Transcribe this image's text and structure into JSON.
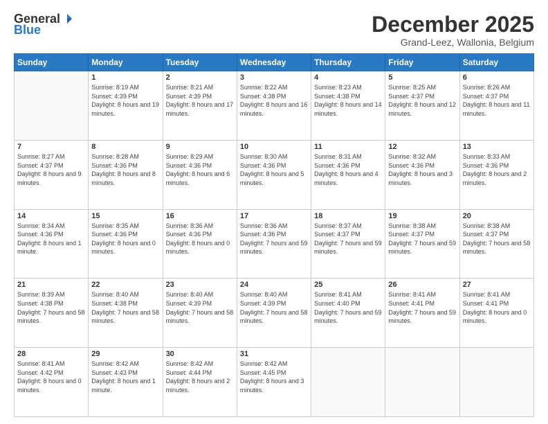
{
  "logo": {
    "general": "General",
    "blue": "Blue"
  },
  "header": {
    "month": "December 2025",
    "location": "Grand-Leez, Wallonia, Belgium"
  },
  "weekdays": [
    "Sunday",
    "Monday",
    "Tuesday",
    "Wednesday",
    "Thursday",
    "Friday",
    "Saturday"
  ],
  "weeks": [
    [
      {
        "day": "",
        "sunrise": "",
        "sunset": "",
        "daylight": ""
      },
      {
        "day": "1",
        "sunrise": "Sunrise: 8:19 AM",
        "sunset": "Sunset: 4:39 PM",
        "daylight": "Daylight: 8 hours and 19 minutes."
      },
      {
        "day": "2",
        "sunrise": "Sunrise: 8:21 AM",
        "sunset": "Sunset: 4:39 PM",
        "daylight": "Daylight: 8 hours and 17 minutes."
      },
      {
        "day": "3",
        "sunrise": "Sunrise: 8:22 AM",
        "sunset": "Sunset: 4:38 PM",
        "daylight": "Daylight: 8 hours and 16 minutes."
      },
      {
        "day": "4",
        "sunrise": "Sunrise: 8:23 AM",
        "sunset": "Sunset: 4:38 PM",
        "daylight": "Daylight: 8 hours and 14 minutes."
      },
      {
        "day": "5",
        "sunrise": "Sunrise: 8:25 AM",
        "sunset": "Sunset: 4:37 PM",
        "daylight": "Daylight: 8 hours and 12 minutes."
      },
      {
        "day": "6",
        "sunrise": "Sunrise: 8:26 AM",
        "sunset": "Sunset: 4:37 PM",
        "daylight": "Daylight: 8 hours and 11 minutes."
      }
    ],
    [
      {
        "day": "7",
        "sunrise": "Sunrise: 8:27 AM",
        "sunset": "Sunset: 4:37 PM",
        "daylight": "Daylight: 8 hours and 9 minutes."
      },
      {
        "day": "8",
        "sunrise": "Sunrise: 8:28 AM",
        "sunset": "Sunset: 4:36 PM",
        "daylight": "Daylight: 8 hours and 8 minutes."
      },
      {
        "day": "9",
        "sunrise": "Sunrise: 8:29 AM",
        "sunset": "Sunset: 4:36 PM",
        "daylight": "Daylight: 8 hours and 6 minutes."
      },
      {
        "day": "10",
        "sunrise": "Sunrise: 8:30 AM",
        "sunset": "Sunset: 4:36 PM",
        "daylight": "Daylight: 8 hours and 5 minutes."
      },
      {
        "day": "11",
        "sunrise": "Sunrise: 8:31 AM",
        "sunset": "Sunset: 4:36 PM",
        "daylight": "Daylight: 8 hours and 4 minutes."
      },
      {
        "day": "12",
        "sunrise": "Sunrise: 8:32 AM",
        "sunset": "Sunset: 4:36 PM",
        "daylight": "Daylight: 8 hours and 3 minutes."
      },
      {
        "day": "13",
        "sunrise": "Sunrise: 8:33 AM",
        "sunset": "Sunset: 4:36 PM",
        "daylight": "Daylight: 8 hours and 2 minutes."
      }
    ],
    [
      {
        "day": "14",
        "sunrise": "Sunrise: 8:34 AM",
        "sunset": "Sunset: 4:36 PM",
        "daylight": "Daylight: 8 hours and 1 minute."
      },
      {
        "day": "15",
        "sunrise": "Sunrise: 8:35 AM",
        "sunset": "Sunset: 4:36 PM",
        "daylight": "Daylight: 8 hours and 0 minutes."
      },
      {
        "day": "16",
        "sunrise": "Sunrise: 8:36 AM",
        "sunset": "Sunset: 4:36 PM",
        "daylight": "Daylight: 8 hours and 0 minutes."
      },
      {
        "day": "17",
        "sunrise": "Sunrise: 8:36 AM",
        "sunset": "Sunset: 4:36 PM",
        "daylight": "Daylight: 7 hours and 59 minutes."
      },
      {
        "day": "18",
        "sunrise": "Sunrise: 8:37 AM",
        "sunset": "Sunset: 4:37 PM",
        "daylight": "Daylight: 7 hours and 59 minutes."
      },
      {
        "day": "19",
        "sunrise": "Sunrise: 8:38 AM",
        "sunset": "Sunset: 4:37 PM",
        "daylight": "Daylight: 7 hours and 59 minutes."
      },
      {
        "day": "20",
        "sunrise": "Sunrise: 8:38 AM",
        "sunset": "Sunset: 4:37 PM",
        "daylight": "Daylight: 7 hours and 58 minutes."
      }
    ],
    [
      {
        "day": "21",
        "sunrise": "Sunrise: 8:39 AM",
        "sunset": "Sunset: 4:38 PM",
        "daylight": "Daylight: 7 hours and 58 minutes."
      },
      {
        "day": "22",
        "sunrise": "Sunrise: 8:40 AM",
        "sunset": "Sunset: 4:38 PM",
        "daylight": "Daylight: 7 hours and 58 minutes."
      },
      {
        "day": "23",
        "sunrise": "Sunrise: 8:40 AM",
        "sunset": "Sunset: 4:39 PM",
        "daylight": "Daylight: 7 hours and 58 minutes."
      },
      {
        "day": "24",
        "sunrise": "Sunrise: 8:40 AM",
        "sunset": "Sunset: 4:39 PM",
        "daylight": "Daylight: 7 hours and 58 minutes."
      },
      {
        "day": "25",
        "sunrise": "Sunrise: 8:41 AM",
        "sunset": "Sunset: 4:40 PM",
        "daylight": "Daylight: 7 hours and 59 minutes."
      },
      {
        "day": "26",
        "sunrise": "Sunrise: 8:41 AM",
        "sunset": "Sunset: 4:41 PM",
        "daylight": "Daylight: 7 hours and 59 minutes."
      },
      {
        "day": "27",
        "sunrise": "Sunrise: 8:41 AM",
        "sunset": "Sunset: 4:41 PM",
        "daylight": "Daylight: 8 hours and 0 minutes."
      }
    ],
    [
      {
        "day": "28",
        "sunrise": "Sunrise: 8:41 AM",
        "sunset": "Sunset: 4:42 PM",
        "daylight": "Daylight: 8 hours and 0 minutes."
      },
      {
        "day": "29",
        "sunrise": "Sunrise: 8:42 AM",
        "sunset": "Sunset: 4:43 PM",
        "daylight": "Daylight: 8 hours and 1 minute."
      },
      {
        "day": "30",
        "sunrise": "Sunrise: 8:42 AM",
        "sunset": "Sunset: 4:44 PM",
        "daylight": "Daylight: 8 hours and 2 minutes."
      },
      {
        "day": "31",
        "sunrise": "Sunrise: 8:42 AM",
        "sunset": "Sunset: 4:45 PM",
        "daylight": "Daylight: 8 hours and 3 minutes."
      },
      {
        "day": "",
        "sunrise": "",
        "sunset": "",
        "daylight": ""
      },
      {
        "day": "",
        "sunrise": "",
        "sunset": "",
        "daylight": ""
      },
      {
        "day": "",
        "sunrise": "",
        "sunset": "",
        "daylight": ""
      }
    ]
  ]
}
